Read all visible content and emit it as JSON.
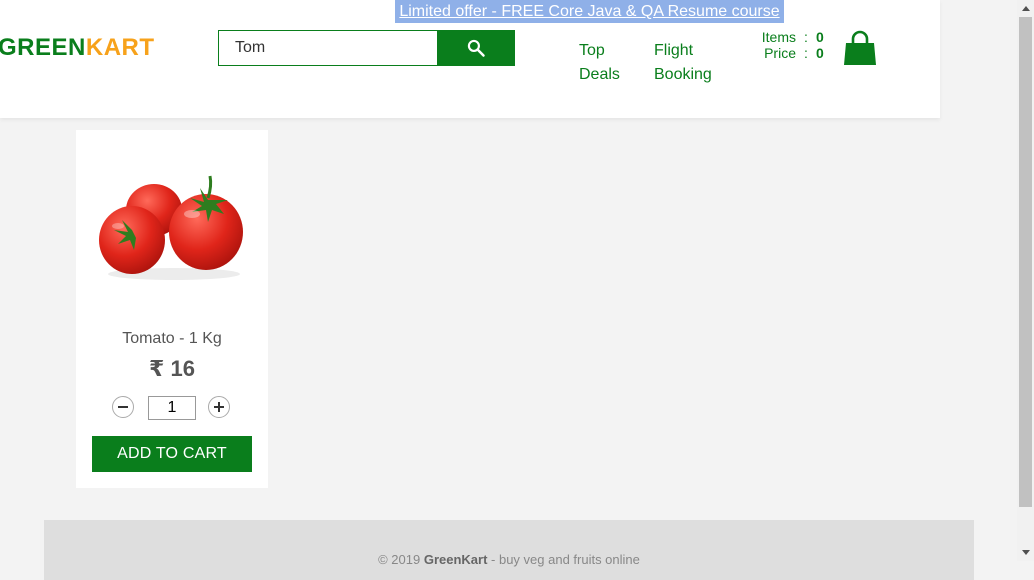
{
  "promo": {
    "text": "Limited offer - FREE Core Java & QA Resume course"
  },
  "logo": {
    "part1": "GREEN",
    "part2": "KART"
  },
  "search": {
    "value": "Tom",
    "icon": "search-icon"
  },
  "nav": [
    {
      "line1": "Top",
      "line2": "Deals"
    },
    {
      "line1": "Flight",
      "line2": "Booking"
    }
  ],
  "cart": {
    "items_label": "Items",
    "items_value": "0",
    "price_label": "Price",
    "price_value": "0",
    "separator": ":",
    "icon": "shopping-bag-icon"
  },
  "product": {
    "name": "Tomato - 1 Kg",
    "price": "₹ 16",
    "quantity": "1",
    "decrement": "–",
    "increment": "+",
    "add_label": "ADD TO CART"
  },
  "footer": {
    "prefix": "© 2019 ",
    "brand": "GreenKart",
    "suffix": " - buy veg and fruits online"
  },
  "colors": {
    "brand_green": "#0a7e1c",
    "brand_orange": "#f7a21b",
    "promo_bg": "#8fb0e8"
  }
}
